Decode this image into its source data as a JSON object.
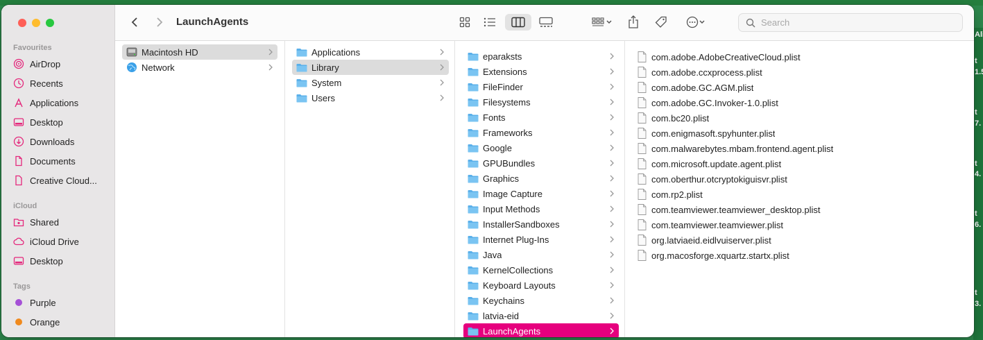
{
  "window": {
    "title": "LaunchAgents",
    "search": {
      "placeholder": "Search"
    }
  },
  "sidebar": {
    "favourites_heading": "Favourites",
    "favourites": [
      {
        "label": "AirDrop",
        "icon": "airdrop-icon"
      },
      {
        "label": "Recents",
        "icon": "clock-icon"
      },
      {
        "label": "Applications",
        "icon": "applications-icon"
      },
      {
        "label": "Desktop",
        "icon": "desktop-icon"
      },
      {
        "label": "Downloads",
        "icon": "download-icon"
      },
      {
        "label": "Documents",
        "icon": "document-icon"
      },
      {
        "label": "Creative Cloud...",
        "icon": "file-icon"
      }
    ],
    "icloud_heading": "iCloud",
    "icloud": [
      {
        "label": "Shared",
        "icon": "shared-folder-icon"
      },
      {
        "label": "iCloud Drive",
        "icon": "cloud-icon"
      },
      {
        "label": "Desktop",
        "icon": "desktop-icon"
      }
    ],
    "tags_heading": "Tags",
    "tags": [
      {
        "label": "Purple",
        "color": "#a550d6"
      },
      {
        "label": "Orange",
        "color": "#f08a1e"
      }
    ]
  },
  "columns": {
    "col1": [
      "Macintosh HD",
      "Network"
    ],
    "col2": [
      "Applications",
      "Library",
      "System",
      "Users"
    ],
    "col3": [
      "eparaksts",
      "Extensions",
      "FileFinder",
      "Filesystems",
      "Fonts",
      "Frameworks",
      "Google",
      "GPUBundles",
      "Graphics",
      "Image Capture",
      "Input Methods",
      "InstallerSandboxes",
      "Internet Plug-Ins",
      "Java",
      "KernelCollections",
      "Keyboard Layouts",
      "Keychains",
      "latvia-eid",
      "LaunchAgents"
    ],
    "col4": [
      "com.adobe.AdobeCreativeCloud.plist",
      "com.adobe.ccxprocess.plist",
      "com.adobe.GC.AGM.plist",
      "com.adobe.GC.Invoker-1.0.plist",
      "com.bc20.plist",
      "com.enigmasoft.spyhunter.plist",
      "com.malwarebytes.mbam.frontend.agent.plist",
      "com.microsoft.update.agent.plist",
      "com.oberthur.otcryptokiguisvr.plist",
      "com.rp2.plist",
      "com.teamviewer.teamviewer_desktop.plist",
      "com.teamviewer.teamviewer.plist",
      "org.latviaeid.eidlvuiserver.plist",
      "org.macosforge.xquartz.startx.plist"
    ]
  },
  "desktop_edge": {
    "fragments": [
      "Ali",
      "t",
      "1.5",
      "t",
      "7.",
      "t",
      "4.",
      "t",
      "6.",
      "t",
      "3."
    ]
  },
  "colors": {
    "accent": "#e6007e",
    "folder": "#5ab0ea",
    "sidebar_icon": "#e4287c"
  }
}
